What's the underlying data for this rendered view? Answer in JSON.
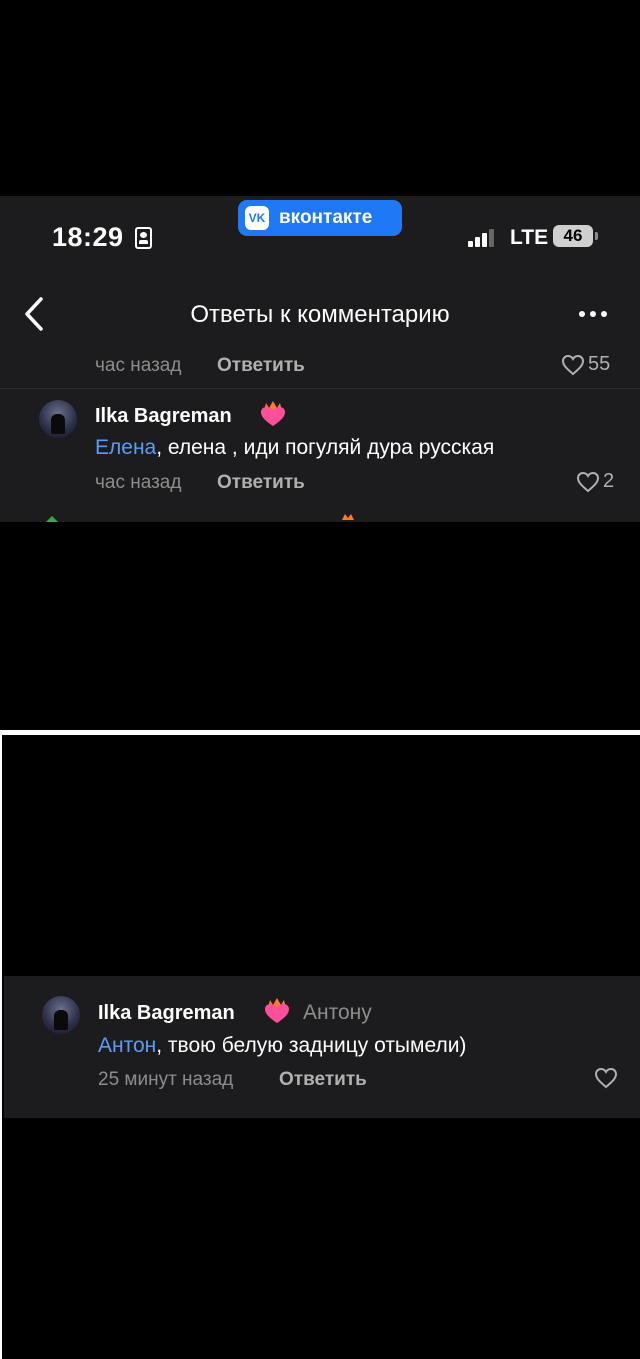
{
  "status_bar": {
    "time": "18:29",
    "pill_brand": "вконтакте",
    "pill_logo": "VK",
    "network": "LTE",
    "battery": "46",
    "accent_color": "#1f78f5"
  },
  "nav": {
    "title": "Ответы к комментарию"
  },
  "top_panel": {
    "previous_comment": {
      "time": "час назад",
      "reply_label": "Ответить",
      "likes": "55"
    },
    "comment": {
      "author": "Ilka Bagreman",
      "mention": "Елена",
      "text": ", елена , иди погуляй дура русская",
      "time": "час назад",
      "reply_label": "Ответить",
      "likes": "2"
    }
  },
  "bottom_panel": {
    "comment": {
      "author": "Ilka Bagreman",
      "reply_to": "Антону",
      "mention": "Антон",
      "text": ", твою белую задницу отымели)",
      "time": "25 минут назад",
      "reply_label": "Ответить",
      "likes": ""
    }
  },
  "colors": {
    "background": "#000000",
    "panel": "#1c1c1e",
    "mention": "#5b9cf5",
    "muted": "#8d8d8d"
  }
}
